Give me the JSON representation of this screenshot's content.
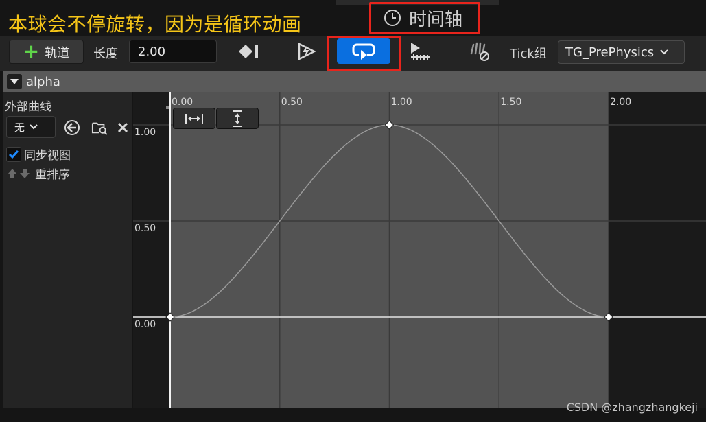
{
  "annotation": {
    "note": "本球会不停旋转，因为是循环动画",
    "highlight_color": "#e8241c",
    "note_color": "#f5c518"
  },
  "tab": {
    "title": "时间轴",
    "icon": "clock-icon"
  },
  "toolbar": {
    "add_track_label": "轨道",
    "length_label": "长度",
    "length_value": "2.00",
    "tick_label": "Tick组",
    "tick_group_value": "TG_PrePhysics",
    "loop_active": true,
    "loop_color": "#0a6fe0",
    "icons": [
      "add-key-icon",
      "autoplay-icon",
      "loop-icon",
      "use-last-keyframe-icon",
      "ignore-time-dilation-icon"
    ]
  },
  "track": {
    "name": "alpha"
  },
  "left_panel": {
    "external_curve_label": "外部曲线",
    "external_curve_value": "无",
    "sync_view_label": "同步视图",
    "sync_view_checked": true,
    "reorder_label": "重排序"
  },
  "chart_data": {
    "type": "line",
    "x_ticks": [
      "0.00",
      "0.50",
      "1.00",
      "1.50",
      "2.00"
    ],
    "y_ticks": [
      "1.00",
      "0.50",
      "0.00"
    ],
    "keys": [
      {
        "time": 0.0,
        "value": 0.0
      },
      {
        "time": 1.0,
        "value": 1.0
      },
      {
        "time": 2.0,
        "value": 0.0
      }
    ],
    "xlim": [
      0,
      2
    ],
    "ylim": [
      0,
      1
    ],
    "grid": true
  },
  "watermark": "CSDN @zhangzhangkeji"
}
